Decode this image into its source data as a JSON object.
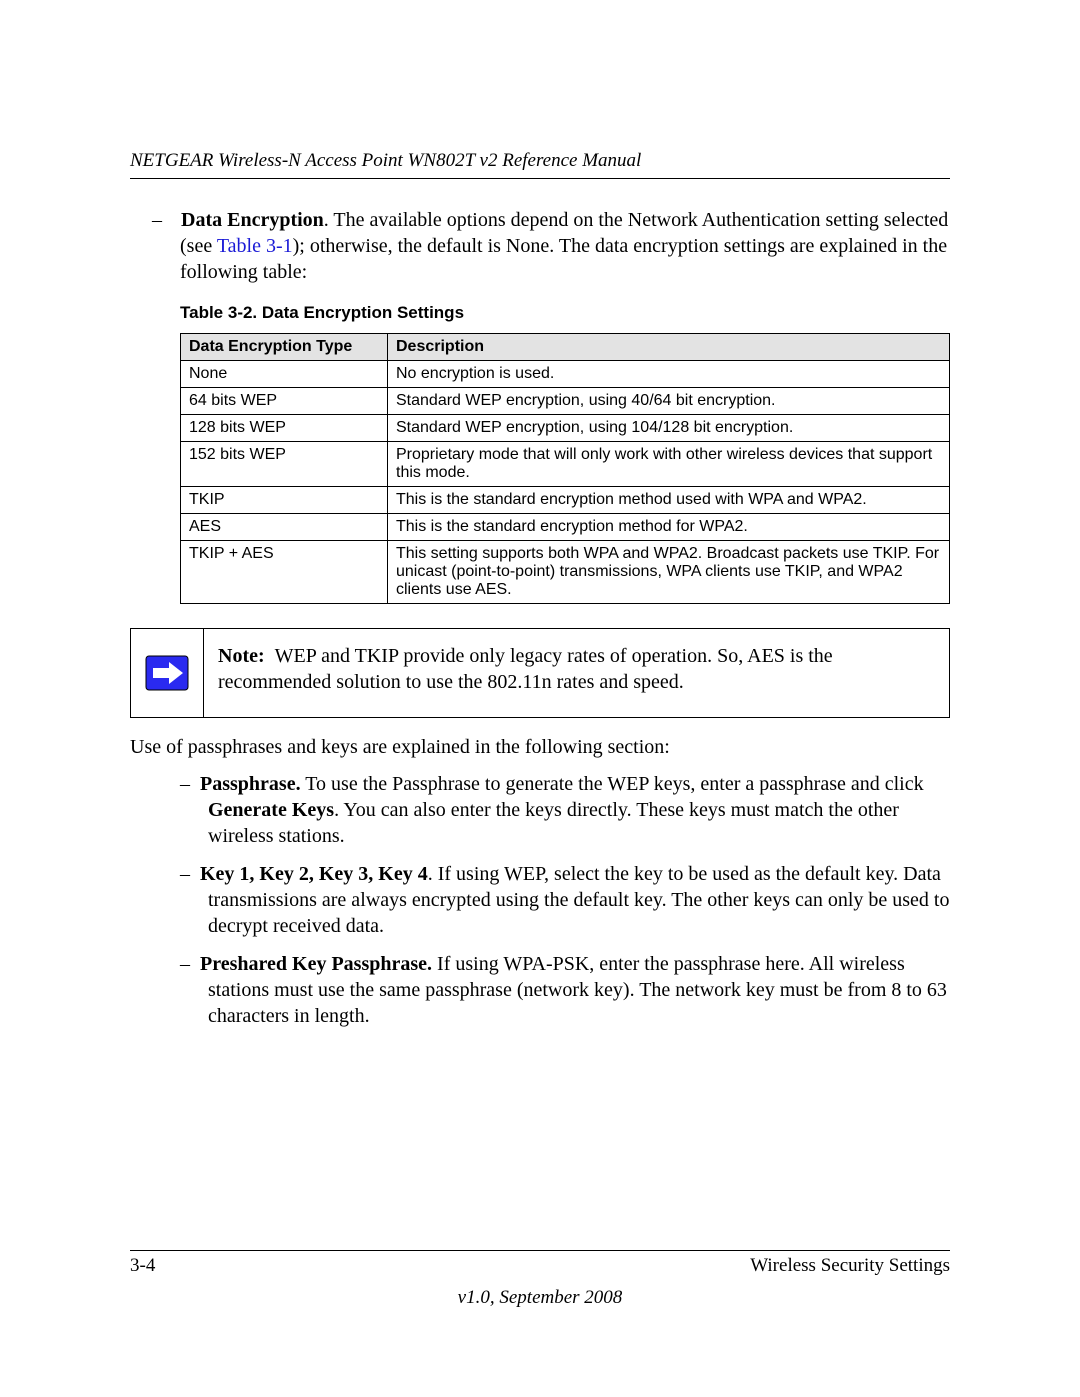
{
  "header": {
    "title": "NETGEAR Wireless-N Access Point WN802T v2 Reference Manual"
  },
  "intro": {
    "label": "Data Encryption",
    "text_before_link": ". The available options depend on the Network Authentication setting selected (see ",
    "link_text": "Table 3-1",
    "text_after_link": "); otherwise, the default is None. The data encryption settings are explained in the following table:"
  },
  "table": {
    "caption": "Table 3-2. Data Encryption Settings",
    "headers": [
      "Data Encryption Type",
      "Description"
    ],
    "rows": [
      {
        "type": "None",
        "desc": "No encryption is used."
      },
      {
        "type": "64 bits WEP",
        "desc": "Standard WEP encryption, using 40/64 bit encryption."
      },
      {
        "type": "128 bits WEP",
        "desc": "Standard WEP encryption, using 104/128 bit encryption."
      },
      {
        "type": "152 bits WEP",
        "desc": "Proprietary mode that will only work with other wireless devices that support this mode."
      },
      {
        "type": "TKIP",
        "desc": "This is the standard encryption method used with WPA and WPA2."
      },
      {
        "type": "AES",
        "desc": "This is the standard encryption method for WPA2."
      },
      {
        "type": "TKIP + AES",
        "desc": "This setting supports both WPA and WPA2. Broadcast packets use TKIP. For unicast (point-to-point) transmissions, WPA clients use TKIP, and WPA2 clients use AES."
      }
    ]
  },
  "note": {
    "label": "Note:",
    "text": "WEP and TKIP provide only legacy rates of operation. So, AES is the recommended solution to use the 802.11n rates and speed."
  },
  "lead": "Use of passphrases and keys are explained in the following section:",
  "bullets": [
    {
      "label": "Passphrase.",
      "text_before": " To use the Passphrase to generate the WEP keys, enter a passphrase and click ",
      "bold_inline": "Generate Keys",
      "text_after": ". You can also enter the keys directly. These keys must match the other wireless stations."
    },
    {
      "label": "Key 1, Key 2, Key 3, Key 4",
      "text": ". If using WEP, select the key to be used as the default key. Data transmissions are always encrypted using the default key. The other keys can only be used to decrypt received data."
    },
    {
      "label": "Preshared Key Passphrase.",
      "text": " If using WPA-PSK, enter the passphrase here. All wireless stations must use the same passphrase (network key). The network key must be from 8 to 63 characters in length."
    }
  ],
  "footer": {
    "page": "3-4",
    "section": "Wireless Security Settings",
    "version": "v1.0, September 2008"
  }
}
